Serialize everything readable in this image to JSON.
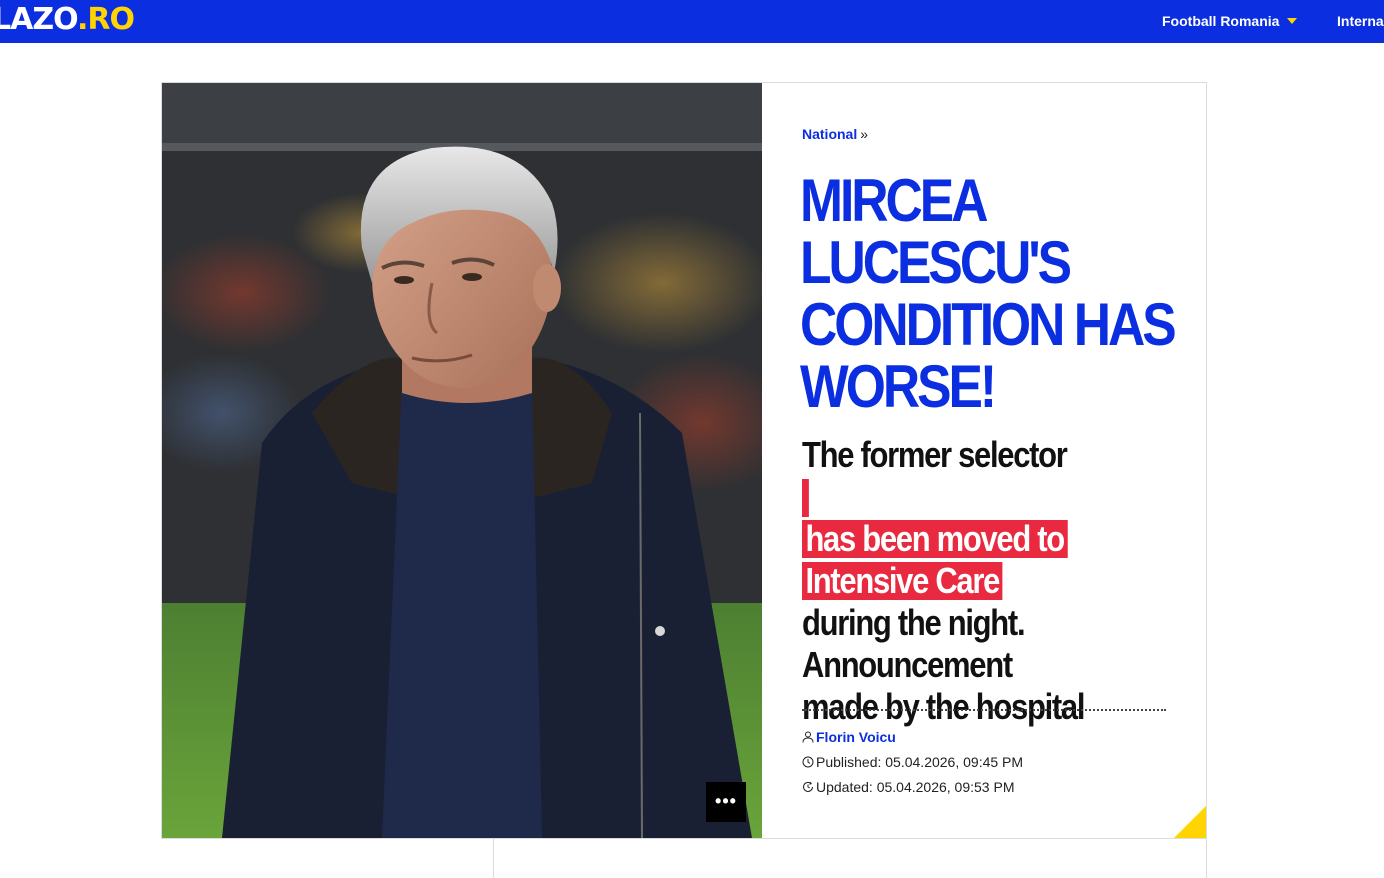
{
  "site": {
    "logo_main": "LAZO",
    "logo_dot": ".",
    "logo_suffix": "RO"
  },
  "nav": {
    "items": [
      {
        "label": "Football Romania",
        "has_dropdown": true
      },
      {
        "label": "Interna"
      }
    ]
  },
  "colors": {
    "brand_blue": "#0b2ee0",
    "accent_yellow": "#ffd400",
    "highlight_red": "#e8293f"
  },
  "photo": {
    "more_button_label": "•••"
  },
  "article": {
    "category": "National",
    "category_separator": "»",
    "headline_lines": [
      "MIRCEA",
      "LUCESCU'S",
      "CONDITION HAS",
      "WORSE!"
    ],
    "subtitle": {
      "line1": "The former selector",
      "highlight1": "has been moved to",
      "highlight2": "Intensive Care",
      "line4": "during the night.",
      "line5": "Announcement",
      "line6": "made by the hospital"
    },
    "author": "Florin Voicu",
    "published": "Published: 05.04.2026, 09:45 PM",
    "updated": "Updated: 05.04.2026, 09:53 PM"
  }
}
